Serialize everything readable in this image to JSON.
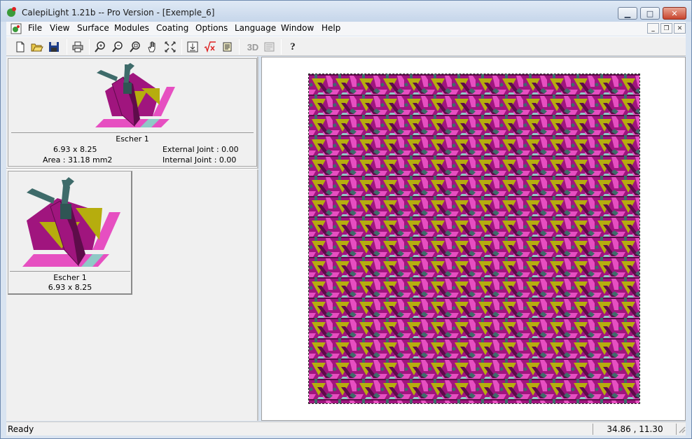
{
  "window": {
    "title": "CalepiLight 1.21b -- Pro Version - [Exemple_6]",
    "caption_buttons": [
      "minimize",
      "maximize",
      "close"
    ]
  },
  "menu": [
    "File",
    "View",
    "Surface",
    "Modules",
    "Coating",
    "Options",
    "Language",
    "Window",
    "Help"
  ],
  "toolbar": {
    "label_3d": "3D",
    "help_label": "?",
    "icons": [
      "new-icon",
      "open-icon",
      "save-icon",
      "print-icon",
      "zoom-in-icon",
      "zoom-out-icon",
      "zoom-fit-icon",
      "pan-hand-icon",
      "fit-extent-icon",
      "insert-module-icon",
      "formula-icon",
      "report-icon",
      "3d-icon",
      "render-icon",
      "help-icon"
    ]
  },
  "modules_panel": {
    "card1": {
      "name": "Escher 1",
      "size": "6.93 x 8.25",
      "area": "Area : 31.18 mm2",
      "external_joint": "External Joint : 0.00",
      "internal_joint": "Internal Joint : 0.00"
    },
    "card2": {
      "name": "Escher 1",
      "size": "6.93 x 8.25"
    }
  },
  "status": {
    "text": "Ready",
    "coords": "34.86 , 11.30"
  },
  "colors": {
    "magenta": "#a0157e",
    "pink": "#e64fc1",
    "olive": "#b6ad0e",
    "teal": "#3e6b6a",
    "light_teal": "#8fc9c6",
    "dark": "#5e0c4a"
  }
}
